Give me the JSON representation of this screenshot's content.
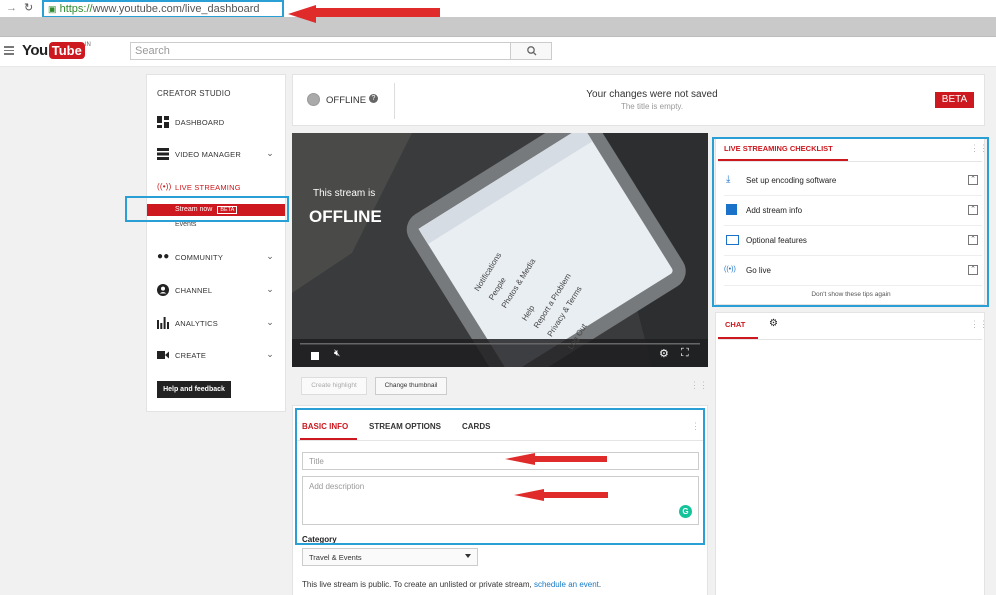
{
  "browser": {
    "url_scheme": "https://",
    "url_rest": "www.youtube.com/live_dashboard",
    "back_icon": "back-arrow-icon",
    "reload_icon": "reload-icon",
    "lock_icon": "lock-icon"
  },
  "masthead": {
    "logo_you": "You",
    "logo_tube": "Tube",
    "logo_region": "IN",
    "search_placeholder": "Search",
    "search_icon": "magnifier-icon"
  },
  "sidebar": {
    "heading": "CREATOR STUDIO",
    "items": [
      {
        "label": "DASHBOARD",
        "icon": "dashboard-icon"
      },
      {
        "label": "VIDEO MANAGER",
        "icon": "video-manager-icon"
      },
      {
        "label": "LIVE STREAMING",
        "icon": "live-streaming-icon"
      },
      {
        "label": "COMMUNITY",
        "icon": "community-icon"
      },
      {
        "label": "CHANNEL",
        "icon": "channel-icon"
      },
      {
        "label": "ANALYTICS",
        "icon": "analytics-icon"
      },
      {
        "label": "CREATE",
        "icon": "create-icon"
      }
    ],
    "sub_stream_now": "Stream now",
    "sub_beta": "BETA",
    "sub_events": "Events",
    "help_button": "Help and feedback"
  },
  "status": {
    "offline_label": "OFFLINE",
    "help_icon": "question-icon",
    "save_title": "Your changes were not saved",
    "save_sub": "The title is empty.",
    "beta": "BETA"
  },
  "player": {
    "stream_is": "This stream is",
    "offline_big": "OFFLINE",
    "stop_icon": "stop-icon",
    "mute_icon": "mute-icon",
    "settings_icon": "gear-icon",
    "fullscreen_icon": "fullscreen-icon",
    "phone_menu": [
      "Notifications",
      "People",
      "Photos & Media",
      "Help",
      "Report a Problem",
      "Privacy & Terms",
      "Log Out"
    ]
  },
  "below_player": {
    "create_highlight": "Create highlight",
    "change_thumbnail": "Change thumbnail"
  },
  "info": {
    "tabs": [
      "BASIC INFO",
      "STREAM OPTIONS",
      "CARDS"
    ],
    "title_placeholder": "Title",
    "description_placeholder": "Add description",
    "grammarly_icon": "grammarly-icon",
    "category_label": "Category",
    "category_value": "Travel & Events",
    "public_text": "This live stream is public. To create an unlisted or private stream, ",
    "public_link": "schedule an event",
    "public_end": "."
  },
  "checklist": {
    "title": "LIVE STREAMING CHECKLIST",
    "items": [
      {
        "label": "Set up encoding software",
        "icon": "download-icon"
      },
      {
        "label": "Add stream info",
        "icon": "info-grid-icon"
      },
      {
        "label": "Optional features",
        "icon": "card-icon"
      },
      {
        "label": "Go live",
        "icon": "broadcast-icon"
      }
    ],
    "dont_show": "Don't show these tips again"
  },
  "chat": {
    "tab": "CHAT",
    "settings_icon": "gear-icon"
  },
  "colors": {
    "accent_red": "#cc181e",
    "annotation_blue": "#2a9fd6",
    "annotation_red": "#e02b2b",
    "link_blue": "#167ac6"
  }
}
